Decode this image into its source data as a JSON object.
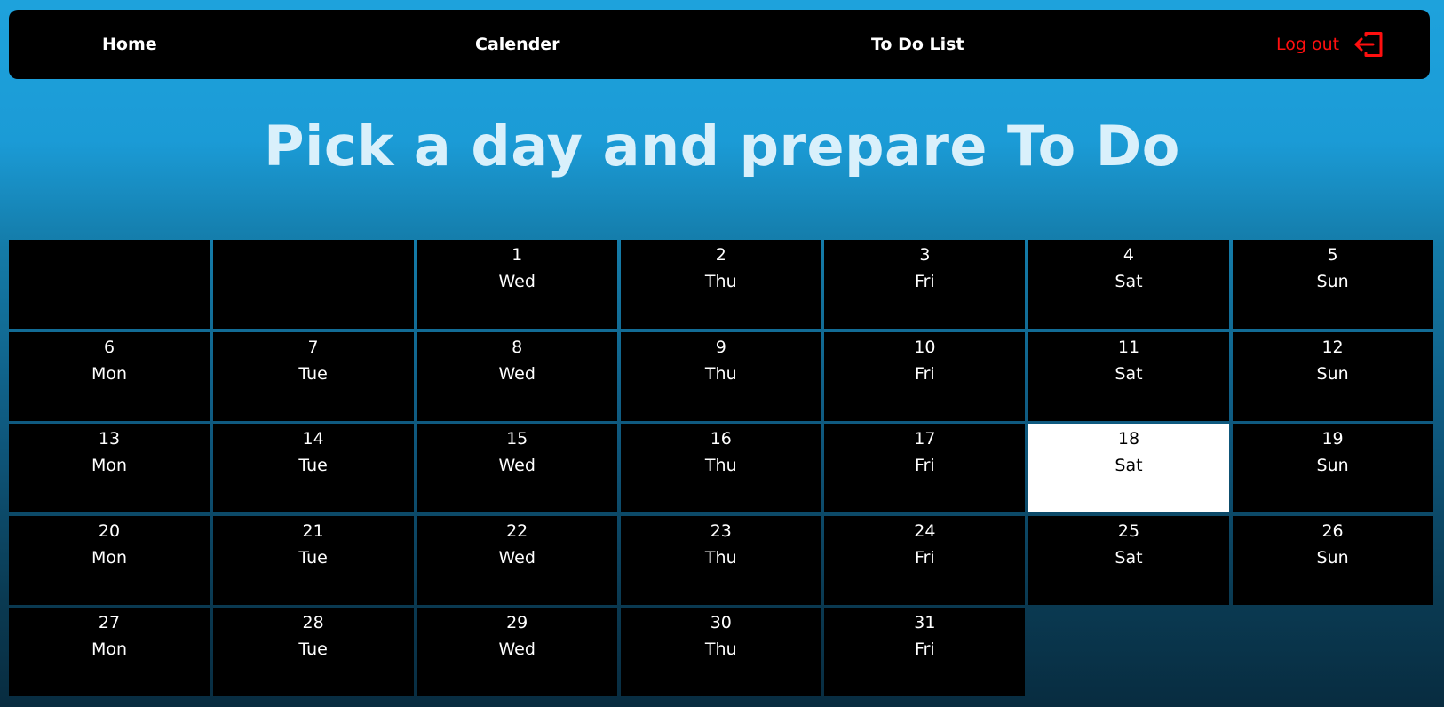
{
  "nav": {
    "home": "Home",
    "calendar": "Calender",
    "todo": "To Do List",
    "logout": "Log out",
    "logout_icon": "logout-icon"
  },
  "header": {
    "title": "Pick a day and prepare To Do"
  },
  "colors": {
    "logout": "#ff0f0f",
    "selected_cell": "#ffffff",
    "cell": "#000000"
  },
  "calendar": {
    "leading_empty": 2,
    "trailing_blank": 2,
    "selected_day": "18",
    "days": [
      {
        "num": "1",
        "name": "Wed"
      },
      {
        "num": "2",
        "name": "Thu"
      },
      {
        "num": "3",
        "name": "Fri"
      },
      {
        "num": "4",
        "name": "Sat"
      },
      {
        "num": "5",
        "name": "Sun"
      },
      {
        "num": "6",
        "name": "Mon"
      },
      {
        "num": "7",
        "name": "Tue"
      },
      {
        "num": "8",
        "name": "Wed"
      },
      {
        "num": "9",
        "name": "Thu"
      },
      {
        "num": "10",
        "name": "Fri"
      },
      {
        "num": "11",
        "name": "Sat"
      },
      {
        "num": "12",
        "name": "Sun"
      },
      {
        "num": "13",
        "name": "Mon"
      },
      {
        "num": "14",
        "name": "Tue"
      },
      {
        "num": "15",
        "name": "Wed"
      },
      {
        "num": "16",
        "name": "Thu"
      },
      {
        "num": "17",
        "name": "Fri"
      },
      {
        "num": "18",
        "name": "Sat"
      },
      {
        "num": "19",
        "name": "Sun"
      },
      {
        "num": "20",
        "name": "Mon"
      },
      {
        "num": "21",
        "name": "Tue"
      },
      {
        "num": "22",
        "name": "Wed"
      },
      {
        "num": "23",
        "name": "Thu"
      },
      {
        "num": "24",
        "name": "Fri"
      },
      {
        "num": "25",
        "name": "Sat"
      },
      {
        "num": "26",
        "name": "Sun"
      },
      {
        "num": "27",
        "name": "Mon"
      },
      {
        "num": "28",
        "name": "Tue"
      },
      {
        "num": "29",
        "name": "Wed"
      },
      {
        "num": "30",
        "name": "Thu"
      },
      {
        "num": "31",
        "name": "Fri"
      }
    ]
  }
}
